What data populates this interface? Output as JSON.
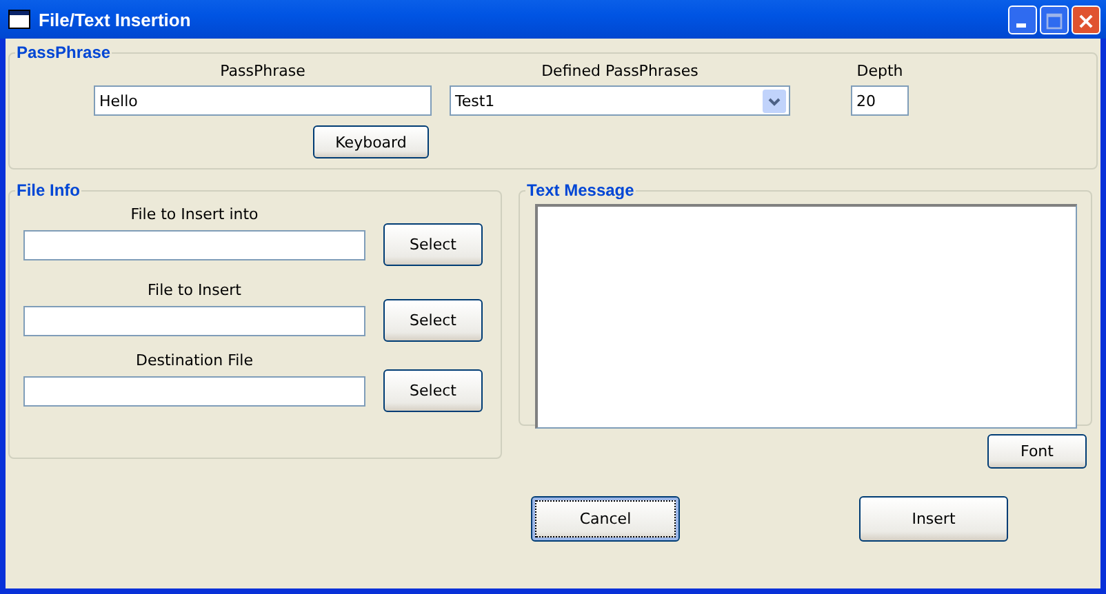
{
  "window": {
    "title": "File/Text Insertion"
  },
  "passphrase_group": {
    "title": "PassPhrase",
    "passphrase": {
      "label": "PassPhrase",
      "value": "Hello"
    },
    "defined": {
      "label": "Defined PassPhrases",
      "value": "Test1"
    },
    "depth": {
      "label": "Depth",
      "value": "20"
    },
    "keyboard_button": "Keyboard"
  },
  "file_info": {
    "title": "File Info",
    "fields": [
      {
        "label": "File to Insert into",
        "button": "Select"
      },
      {
        "label": "File to Insert",
        "button": "Select"
      },
      {
        "label": "Destination File",
        "button": "Select"
      }
    ]
  },
  "text_message": {
    "title": "Text Message",
    "font_button": "Font"
  },
  "buttons": [
    {
      "label": "Cancel",
      "focused": true
    },
    {
      "label": "Insert",
      "focused": false
    }
  ]
}
